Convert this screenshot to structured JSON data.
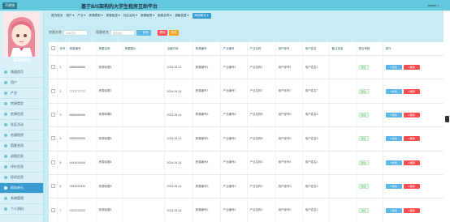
{
  "header": {
    "brand": "不收钱",
    "title": "基于B/S架构的大学生租房互助平台",
    "user": "admin",
    "user_caret": "▾"
  },
  "sidebar": {
    "username": "admin",
    "items": [
      {
        "label": "频道首页"
      },
      {
        "label": "用户"
      },
      {
        "label": "产业"
      },
      {
        "label": "房源类型"
      },
      {
        "label": "房源信息"
      },
      {
        "label": "社区活动"
      },
      {
        "label": "房源租赁"
      },
      {
        "label": "租客合同"
      },
      {
        "label": "退租信息"
      },
      {
        "label": "评价信息"
      },
      {
        "label": "投诉信息"
      },
      {
        "label": "网站单元",
        "active": true
      },
      {
        "label": "系统管理"
      },
      {
        "label": "个人资料"
      }
    ]
  },
  "nav": {
    "items": [
      {
        "label": "首页首页"
      },
      {
        "label": "用户 ▾"
      },
      {
        "label": "产业 ▾"
      },
      {
        "label": "房源类型 ▾"
      },
      {
        "label": "房源信息 ▾"
      },
      {
        "label": "社区活动 ▾"
      },
      {
        "label": "房源租赁 ▾"
      },
      {
        "label": "租客合同 ▾"
      },
      {
        "label": "退租信息 ▾"
      },
      {
        "label": "网站单元 ▾",
        "current": true
      }
    ]
  },
  "search": {
    "label1": "房屋名称",
    "placeholder1": "房屋名称",
    "label2": "租客姓名",
    "placeholder2": "租客姓名",
    "query_label": "查询",
    "delete_label": "删除",
    "export_label": "导出"
  },
  "table": {
    "columns": [
      "",
      "序号",
      "房屋编号",
      "房屋名称",
      "房屋图片",
      "出租时间",
      "房源编号",
      "产业编号",
      "产业名称",
      "用户帐号",
      "用户姓名",
      "备注信息",
      "是否审核",
      "操作"
    ],
    "edit_label": "修改",
    "delete_label": "删除",
    "rows": [
      {
        "no": "1",
        "code": "8888888888",
        "name": "房源标题1",
        "time": "2024-05-14",
        "house": "房源编号1",
        "ind": "产业编号1",
        "indname": "产业名称1",
        "acct": "用户帐号1",
        "uname": "用户姓名1",
        "status": "通过"
      },
      {
        "no": "2",
        "code": "7777777777",
        "name": "房源标题7",
        "time": "2024-05-14",
        "house": "房源编号7",
        "ind": "产业编号7",
        "indname": "产业名称7",
        "acct": "用户帐号7",
        "uname": "用户姓名7",
        "status": "通过"
      },
      {
        "no": "3",
        "code": "6666666666",
        "name": "房源标题6",
        "time": "2024-05-14",
        "house": "房源编号6",
        "ind": "产业编号6",
        "indname": "产业名称6",
        "acct": "用户帐号6",
        "uname": "用户姓名6",
        "status": "通过"
      },
      {
        "no": "4",
        "code": "5555555555",
        "name": "房源标题5",
        "time": "2024-05-14",
        "house": "房源编号5",
        "ind": "产业编号5",
        "indname": "产业名称5",
        "acct": "用户帐号5",
        "uname": "用户姓名5",
        "status": "通过"
      },
      {
        "no": "5",
        "code": "4444444444",
        "name": "房源标题4",
        "time": "2024-05-14",
        "house": "房源编号4",
        "ind": "产业编号4",
        "indname": "产业名称4",
        "acct": "用户帐号4",
        "uname": "用户姓名4",
        "status": "通过"
      },
      {
        "no": "6",
        "code": "3333333333",
        "name": "房源标题3",
        "time": "2024-05-14",
        "house": "房源编号3",
        "ind": "产业编号3",
        "indname": "产业名称3",
        "acct": "用户帐号3",
        "uname": "用户姓名3",
        "status": "通过"
      },
      {
        "no": "7",
        "code": "2222222222",
        "name": "房源标题2",
        "time": "2024-05-14",
        "house": "房源编号2",
        "ind": "产业编号2",
        "indname": "产业名称2",
        "acct": "用户帐号2",
        "uname": "用户姓名2",
        "status": "通过"
      }
    ]
  },
  "colors": {
    "topbar": "#63c7df",
    "accent": "#3a9bd0",
    "danger": "#ff4d4f",
    "warning": "#f5a623"
  }
}
